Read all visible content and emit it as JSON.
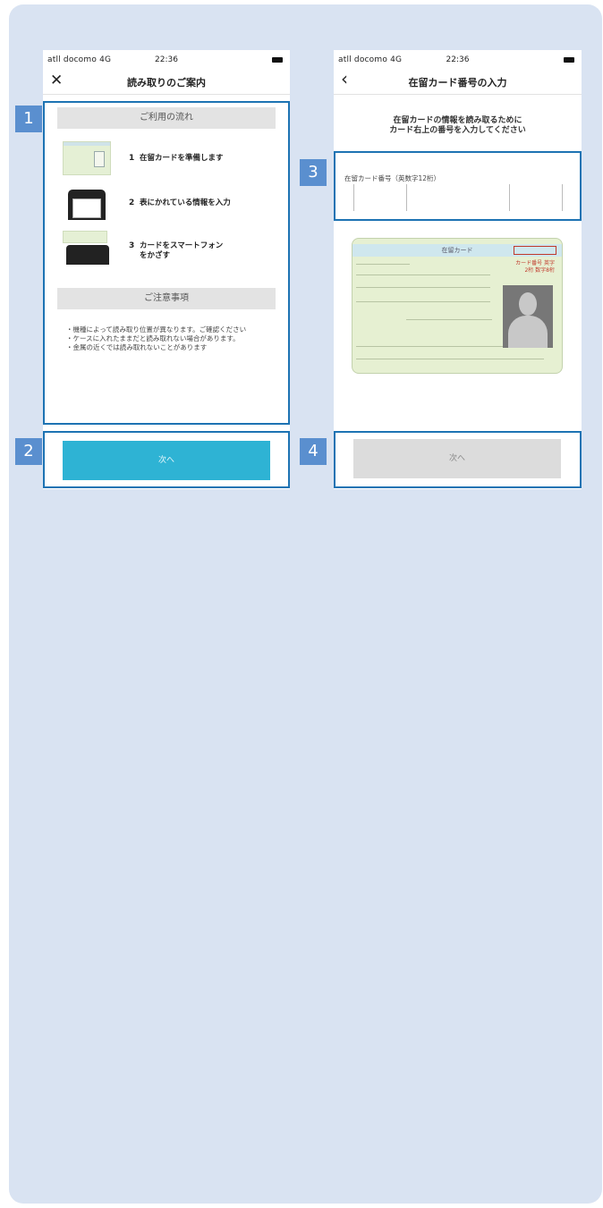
{
  "colors": {
    "panel_bg": "#d9e3f2",
    "highlight": "#1d73b3",
    "marker_bg": "#5a8fcf",
    "primary_button": "#2eb3d4",
    "disabled_button": "#dcdcdc"
  },
  "markers": [
    "1",
    "2",
    "3",
    "4"
  ],
  "left_screen": {
    "status": {
      "carrier": "atll docomo 4G",
      "time": "22:36"
    },
    "nav": {
      "icon": "close-icon",
      "icon_glyph": "✕",
      "title": "読み取りのご案内"
    },
    "flow_heading": "ご利用の流れ",
    "steps": [
      {
        "num": "1",
        "text": "在留カードを準備します"
      },
      {
        "num": "2",
        "text": "表にかれている情報を入力"
      },
      {
        "num": "3",
        "text": "カードをスマートフォンをかざす"
      }
    ],
    "notes_heading": "ご注意事項",
    "notes": [
      "・機種によって読み取り位置が異なります。ご確認ください",
      "・ケースに入れたままだと読み取れない場合があります。",
      "・金属の近くでは読み取れないことがあります"
    ],
    "next_button": "次へ"
  },
  "right_screen": {
    "status": {
      "carrier": "atll docomo 4G",
      "time": "22:36"
    },
    "nav": {
      "icon": "back-chevron-icon",
      "icon_glyph": "‹",
      "title": "在留カード番号の入力"
    },
    "intro_line1": "在留カードの情報を読み取るために",
    "intro_line2": "カード右上の番号を入力してください",
    "field_label": "在留カード番号（英数字12桁）",
    "card_title": "在留カード",
    "card_red_note": "カード番号 英字2桁 数字8桁",
    "next_button": "次へ"
  }
}
